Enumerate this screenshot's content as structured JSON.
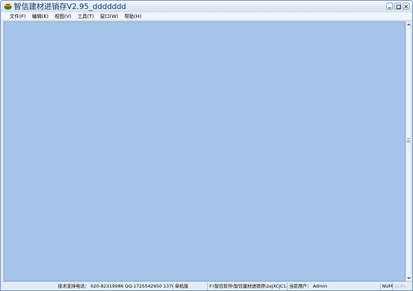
{
  "window": {
    "title": "智信建材进销存V2.95_ddddddd"
  },
  "menubar": {
    "items": [
      {
        "label": "文件(F)"
      },
      {
        "label": "编辑(E)"
      },
      {
        "label": "视图(V)"
      },
      {
        "label": "工具(T)"
      },
      {
        "label": "窗口(W)"
      },
      {
        "label": "帮助(H)"
      }
    ]
  },
  "statusbar": {
    "support_label": "技术支持电话：",
    "support_value": "020-82319986 QQ:1725542950 137028856",
    "mode": "单机版",
    "path": "F:\\智信软件\\智信建材进销存\\zxJXCJC1.sys",
    "user_label": "当前用户：",
    "user_value": "Admin",
    "num_indicator": "NUM",
    "scrl_indicator": "SCRL"
  },
  "colors": {
    "client_background": "#a6c3ea",
    "title_text": "#15355e"
  },
  "icons": {
    "app": "app-icon",
    "minimize": "minimize-icon",
    "maximize": "maximize-icon",
    "close": "close-icon",
    "scroll_up": "arrow-up-icon",
    "scroll_down": "arrow-down-icon"
  }
}
